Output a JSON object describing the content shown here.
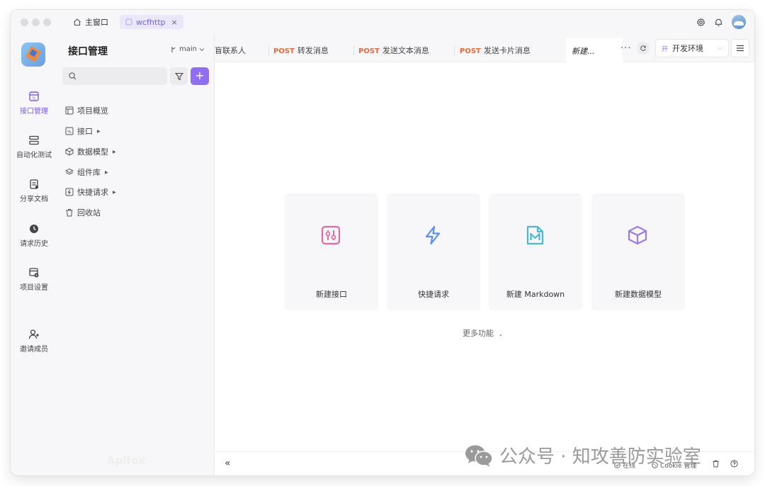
{
  "window": {
    "tabs": [
      {
        "label": "主窗口",
        "icon": "home-icon"
      },
      {
        "label": "wcfhttp",
        "icon": "project-icon",
        "close": "×"
      }
    ]
  },
  "rail": {
    "items": [
      {
        "label": "接口管理",
        "icon": "api-icon",
        "active": true
      },
      {
        "label": "自动化测试",
        "icon": "automation-icon"
      },
      {
        "label": "分享文档",
        "icon": "share-doc-icon"
      },
      {
        "label": "请求历史",
        "icon": "history-icon"
      },
      {
        "label": "项目设置",
        "icon": "settings-icon"
      },
      {
        "label": "邀请成员",
        "icon": "invite-icon"
      }
    ]
  },
  "tree": {
    "title": "接口管理",
    "branch": "main",
    "items": [
      {
        "label": "项目概览",
        "icon": "overview-icon",
        "expandable": false
      },
      {
        "label": "接口",
        "icon": "api-icon",
        "expandable": true
      },
      {
        "label": "数据模型",
        "icon": "cube-icon",
        "expandable": true
      },
      {
        "label": "组件库",
        "icon": "layers-icon",
        "expandable": true
      },
      {
        "label": "快捷请求",
        "icon": "quick-request-icon",
        "expandable": true
      },
      {
        "label": "回收站",
        "icon": "trash-icon",
        "expandable": false
      }
    ],
    "watermark": "Apifox"
  },
  "main": {
    "tabs": [
      {
        "method": "",
        "label": "盲联系人"
      },
      {
        "method": "POST",
        "label": "转发消息"
      },
      {
        "method": "POST",
        "label": "发送文本消息"
      },
      {
        "method": "POST",
        "label": "发送卡片消息"
      },
      {
        "method": "",
        "label": "新建...",
        "active": true
      }
    ],
    "more": "···",
    "env": {
      "badge": "开",
      "label": "开发环境"
    },
    "cards": [
      {
        "label": "新建接口",
        "icon": "new-api-icon",
        "color": "#e06aa9"
      },
      {
        "label": "快捷请求",
        "icon": "lightning-icon",
        "color": "#5b8ff0"
      },
      {
        "label": "新建 Markdown",
        "icon": "markdown-icon",
        "color": "#4bb8cf"
      },
      {
        "label": "新建数据模型",
        "icon": "cube-icon",
        "color": "#9b7be8"
      }
    ],
    "more_features": "更多功能"
  },
  "status": {
    "collapse": "«",
    "online": "在线",
    "cookie": "Cookie 管理"
  },
  "watermark_overlay": "公众号 · 知攻善防实验室",
  "colors": {
    "accent": "#8f6ef0",
    "method_post": "#e8683a"
  }
}
